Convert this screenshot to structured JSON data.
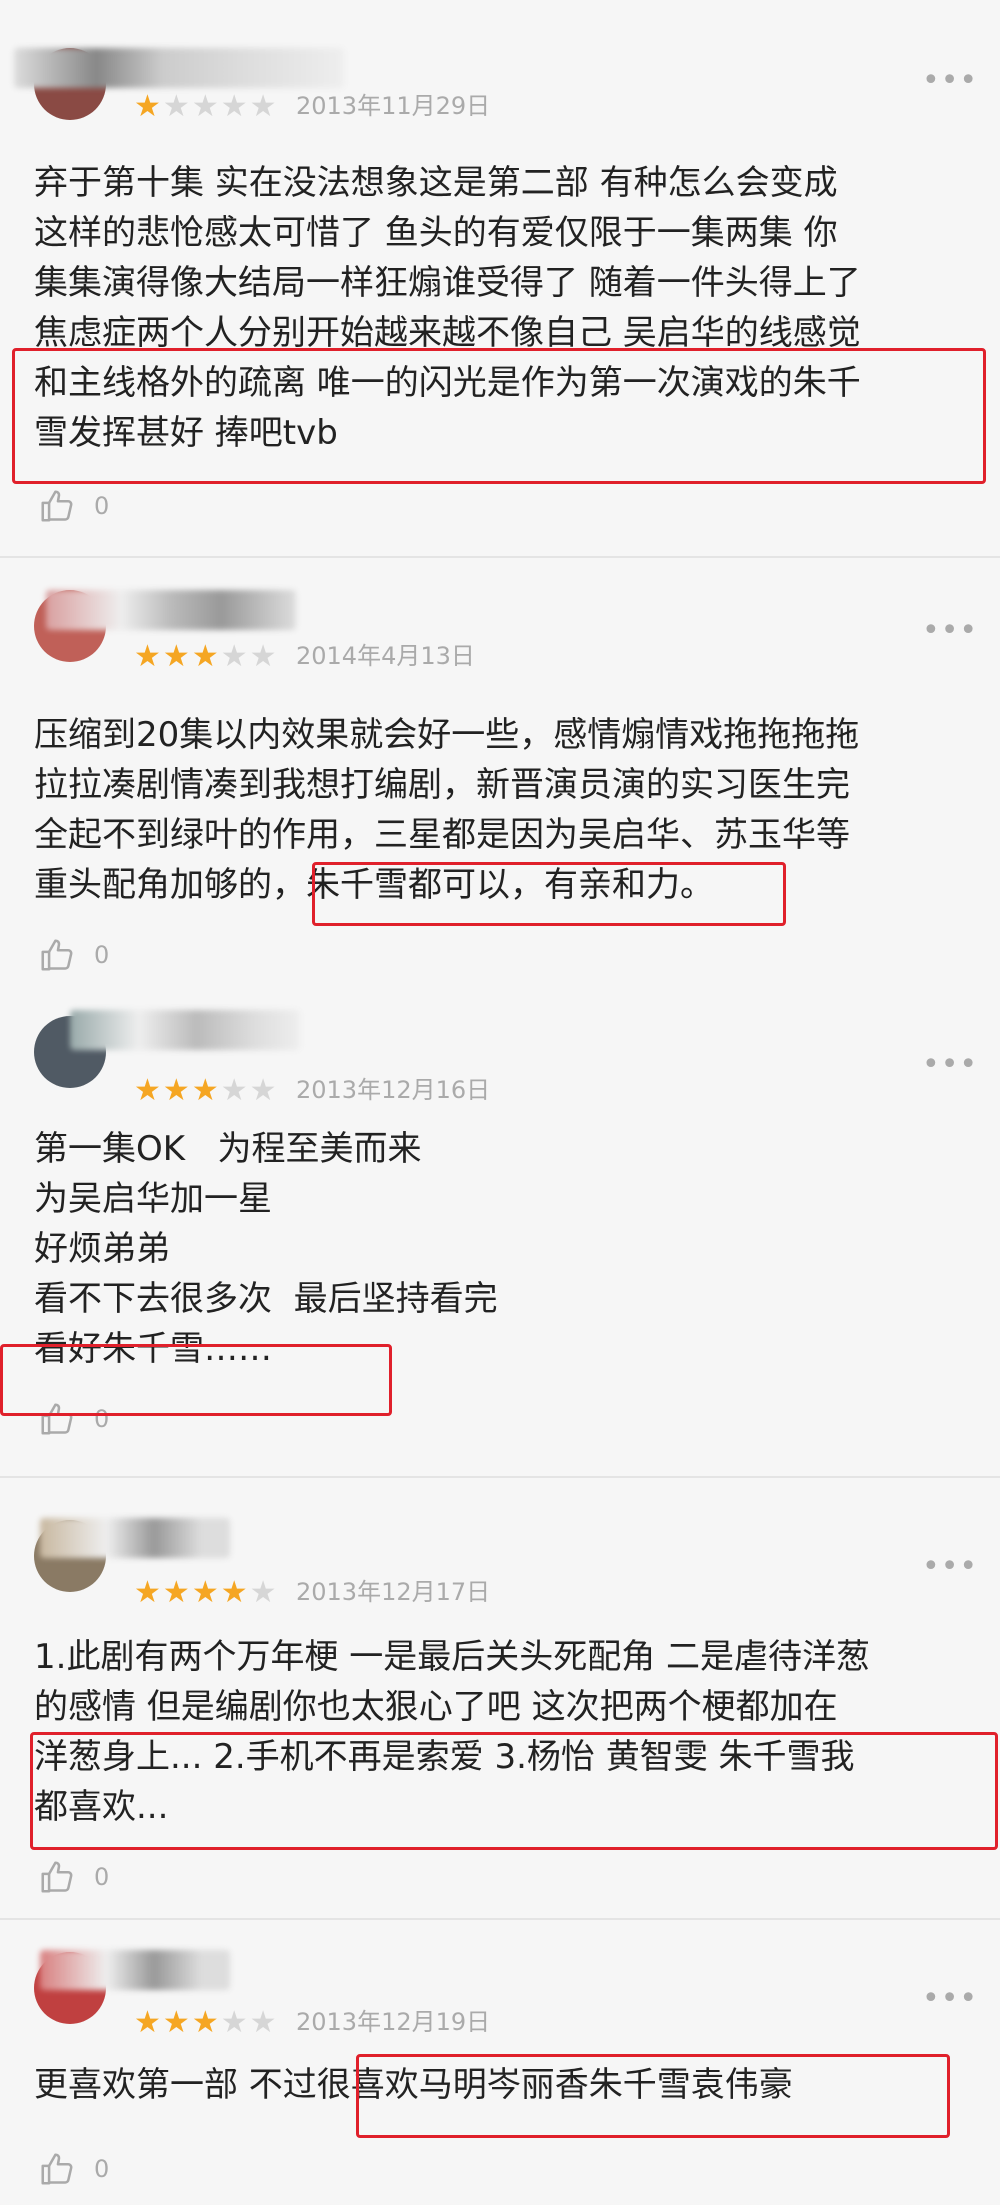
{
  "reviews": [
    {
      "date": "2013年11月29日",
      "stars": 1,
      "text": "弃于第十集 实在没法想象这是第二部 有种怎么会变成\n这样的悲怆感太可惜了 鱼头的有爱仅限于一集两集 你\n集集演得像大结局一样狂煽谁受得了 随着一件头得上了\n焦虑症两个人分别开始越来越不像自己 吴启华的线感觉\n和主线格外的疏离 唯一的闪光是作为第一次演戏的朱千\n雪发挥甚好 捧吧tvb",
      "likes": "0",
      "avatar_color": "#a0524a"
    },
    {
      "date": "2014年4月13日",
      "stars": 3,
      "text": "压缩到20集以内效果就会好一些，感情煽情戏拖拖拖拖\n拉拉凑剧情凑到我想打编剧，新晋演员演的实习医生完\n全起不到绿叶的作用，三星都是因为吴启华、苏玉华等\n重头配角加够的，朱千雪都可以，有亲和力。",
      "likes": "0",
      "avatar_color": "#c0605a"
    },
    {
      "date": "2013年12月16日",
      "stars": 3,
      "text": "第一集OK   为程至美而来\n为吴启华加一星\n好烦弟弟\n看不下去很多次  最后坚持看完\n看好朱千雪……",
      "likes": "0",
      "avatar_color": "#505a64"
    },
    {
      "date": "2013年12月17日",
      "stars": 4,
      "text": "1.此剧有两个万年梗 一是最后关头死配角 二是虐待洋葱\n的感情 但是编剧你也太狠心了吧 这次把两个梗都加在\n洋葱身上... 2.手机不再是索爱 3.杨怡 黄智雯 朱千雪我\n都喜欢...",
      "likes": "0",
      "avatar_color": "#8a7a64"
    },
    {
      "date": "2013年12月19日",
      "stars": 3,
      "text": "更喜欢第一部 不过很喜欢马明岑丽香朱千雪袁伟豪",
      "likes": "0",
      "avatar_color": "#c04040"
    }
  ],
  "ui": {
    "more_glyph": "•••",
    "star_glyph": "★"
  },
  "colors": {
    "star_on": "#f5a623",
    "star_off": "#d6d6d6",
    "highlight": "#e0202b",
    "background": "#f6f6f6"
  }
}
